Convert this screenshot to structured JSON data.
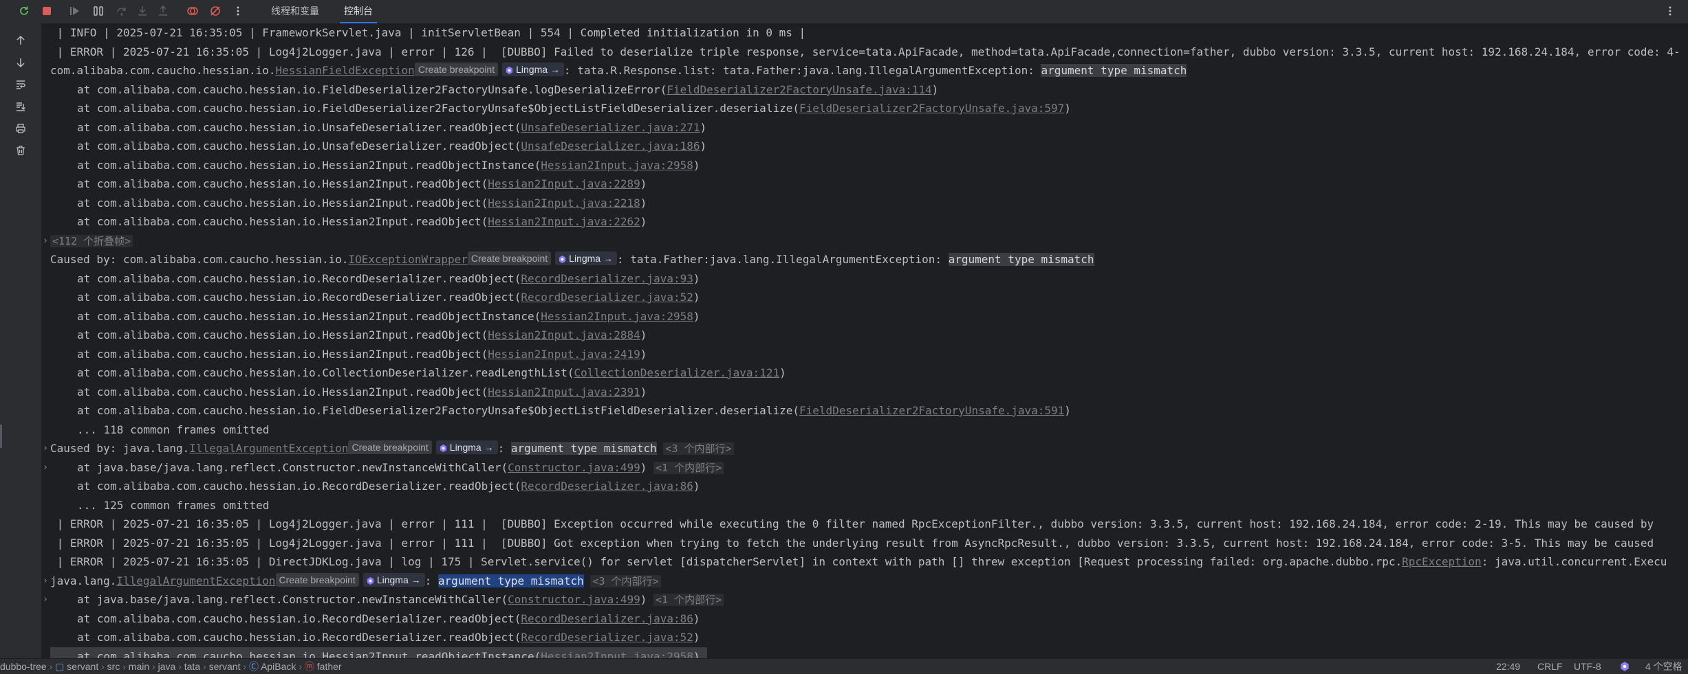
{
  "toolbar": {
    "tabs": [
      {
        "label": "线程和变量",
        "active": false
      },
      {
        "label": "控制台",
        "active": true
      }
    ],
    "icons": [
      "rerun-icon",
      "stop-icon",
      "resume-icon",
      "pause-icon",
      "step-over-icon",
      "step-into-icon",
      "step-out-icon",
      "view-breakpoints-icon",
      "mute-breakpoints-icon",
      "more-icon"
    ]
  },
  "gutter": {
    "icons": [
      "up-arrow-icon",
      "down-arrow-icon",
      "soft-wrap-icon",
      "scroll-to-end-icon",
      "print-icon",
      "clear-all-icon"
    ]
  },
  "inline": {
    "create_breakpoint": "Create breakpoint",
    "lingma": "Lingma",
    "lingma_arrow": "→"
  },
  "console": {
    "l1": " | INFO | 2025-07-21 16:35:05 | FrameworkServlet.java | initServletBean | 554 | Completed initialization in 0 ms |",
    "l2": " | ERROR | 2025-07-21 16:35:05 | Log4j2Logger.java | error | 126 |  [DUBBO] Failed to deserialize triple response, service=tata.ApiFacade, method=tata.ApiFacade,connection=father, dubbo version: 3.3.5, current host: 192.168.24.184, error code: 4-",
    "l3": {
      "prefix": "com.alibaba.com.caucho.hessian.io.",
      "cls": "HessianFieldException",
      "mid": ": tata.R.Response.list: tata.Father:java.lang.IllegalArgumentException: ",
      "msg": "argument type mismatch"
    },
    "frames1": [
      {
        "text": "at com.alibaba.com.caucho.hessian.io.FieldDeserializer2FactoryUnsafe.logDeserializeError(",
        "link": "FieldDeserializer2FactoryUnsafe.java:114"
      },
      {
        "text": "at com.alibaba.com.caucho.hessian.io.FieldDeserializer2FactoryUnsafe$ObjectListFieldDeserializer.deserialize(",
        "link": "FieldDeserializer2FactoryUnsafe.java:597"
      },
      {
        "text": "at com.alibaba.com.caucho.hessian.io.UnsafeDeserializer.readObject(",
        "link": "UnsafeDeserializer.java:271"
      },
      {
        "text": "at com.alibaba.com.caucho.hessian.io.UnsafeDeserializer.readObject(",
        "link": "UnsafeDeserializer.java:186"
      },
      {
        "text": "at com.alibaba.com.caucho.hessian.io.Hessian2Input.readObjectInstance(",
        "link": "Hessian2Input.java:2958"
      },
      {
        "text": "at com.alibaba.com.caucho.hessian.io.Hessian2Input.readObject(",
        "link": "Hessian2Input.java:2289"
      },
      {
        "text": "at com.alibaba.com.caucho.hessian.io.Hessian2Input.readObject(",
        "link": "Hessian2Input.java:2218"
      },
      {
        "text": "at com.alibaba.com.caucho.hessian.io.Hessian2Input.readObject(",
        "link": "Hessian2Input.java:2262"
      }
    ],
    "collapsed1": "<112 个折叠帧>",
    "caused1": {
      "prefix": "Caused by: com.alibaba.com.caucho.hessian.io.",
      "cls": "IOExceptionWrapper",
      "mid": ": tata.Father:java.lang.IllegalArgumentException: ",
      "msg": "argument type mismatch"
    },
    "frames2": [
      {
        "text": "at com.alibaba.com.caucho.hessian.io.RecordDeserializer.readObject(",
        "link": "RecordDeserializer.java:93"
      },
      {
        "text": "at com.alibaba.com.caucho.hessian.io.RecordDeserializer.readObject(",
        "link": "RecordDeserializer.java:52"
      },
      {
        "text": "at com.alibaba.com.caucho.hessian.io.Hessian2Input.readObjectInstance(",
        "link": "Hessian2Input.java:2958"
      },
      {
        "text": "at com.alibaba.com.caucho.hessian.io.Hessian2Input.readObject(",
        "link": "Hessian2Input.java:2884"
      },
      {
        "text": "at com.alibaba.com.caucho.hessian.io.Hessian2Input.readObject(",
        "link": "Hessian2Input.java:2419"
      },
      {
        "text": "at com.alibaba.com.caucho.hessian.io.CollectionDeserializer.readLengthList(",
        "link": "CollectionDeserializer.java:121"
      },
      {
        "text": "at com.alibaba.com.caucho.hessian.io.Hessian2Input.readObject(",
        "link": "Hessian2Input.java:2391"
      },
      {
        "text": "at com.alibaba.com.caucho.hessian.io.FieldDeserializer2FactoryUnsafe$ObjectListFieldDeserializer.deserialize(",
        "link": "FieldDeserializer2FactoryUnsafe.java:591"
      }
    ],
    "omitted1": "... 118 common frames omitted",
    "caused2": {
      "prefix": "Caused by: java.lang.",
      "cls": "IllegalArgumentException",
      "mid": ": ",
      "msg": "argument type mismatch",
      "internal": "<3 个内部行>"
    },
    "frame3": {
      "text": "at java.base/jdk.internal.reflect.Constructor.newInstanceWithCaller(",
      "text_display": "at java.base/java.lang.reflect.Constructor.newInstanceWithCaller(",
      "link": "Constructor.java:499",
      "internal": "<1 个内部行>"
    },
    "frame4": {
      "text": "at com.alibaba.com.caucho.hessian.io.RecordDeserializer.readObject(",
      "link": "RecordDeserializer.java:86"
    },
    "omitted2": "... 125 common frames omitted",
    "e1": " | ERROR | 2025-07-21 16:35:05 | Log4j2Logger.java | error | 111 |  [DUBBO] Exception occurred while executing the 0 filter named RpcExceptionFilter., dubbo version: 3.3.5, current host: 192.168.24.184, error code: 2-19. This may be caused by",
    "e2": " | ERROR | 2025-07-21 16:35:05 | Log4j2Logger.java | error | 111 |  [DUBBO] Got exception when trying to fetch the underlying result from AsyncRpcResult., dubbo version: 3.3.5, current host: 192.168.24.184, error code: 3-5. This may be caused",
    "e3": {
      "text": " | ERROR | 2025-07-21 16:35:05 | DirectJDKLog.java | log | 175 | Servlet.service() for servlet [dispatcherServlet] in context with path [] threw exception [Request processing failed: org.apache.dubbo.rpc.",
      "cls": "RpcException",
      "rest": ": java.util.concurrent.Execu"
    },
    "last_exc": {
      "prefix": "java.lang.",
      "cls": "IllegalArgumentException",
      "mid": ": ",
      "msg": "argument type mismatch",
      "internal": "<3 个内部行>"
    },
    "frame5": {
      "text": "at java.base/java.lang.reflect.Constructor.newInstanceWithCaller(",
      "link": "Constructor.java:499",
      "internal": "<1 个内部行>"
    },
    "frames_last": [
      {
        "text": "at com.alibaba.com.caucho.hessian.io.RecordDeserializer.readObject(",
        "link": "RecordDeserializer.java:86"
      },
      {
        "text": "at com.alibaba.com.caucho.hessian.io.RecordDeserializer.readObject(",
        "link": "RecordDeserializer.java:52"
      },
      {
        "text": "at com.alibaba.com.caucho.hessian.io.Hessian2Input.readObjectInstance(",
        "link": "Hessian2Input.java:2958"
      }
    ]
  },
  "statusbar": {
    "breadcrumbs": [
      "dubbo-tree",
      "servant",
      "src",
      "main",
      "java",
      "tata",
      "servant",
      "ApiBack",
      "father"
    ],
    "position": "22:49",
    "line_ending": "CRLF",
    "encoding": "UTF-8",
    "indent": "4 个空格"
  },
  "colors": {
    "background": "#1e1f22",
    "panel": "#2b2d30",
    "text": "#bcbec4",
    "link": "#7a7e85",
    "selection": "#214283",
    "accent": "#3574f0"
  }
}
